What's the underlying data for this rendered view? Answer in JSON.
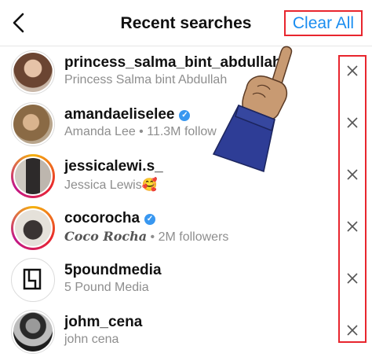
{
  "header": {
    "back_icon": "chevron-left-icon",
    "title": "Recent searches",
    "clear_all_label": "Clear All"
  },
  "colors": {
    "accent_blue": "#1a8df0",
    "highlight_red": "#e8262e",
    "verified_blue": "#3897f0",
    "secondary_text": "#8e8e8e"
  },
  "results": [
    {
      "username": "princess_salma_bint_abdullah",
      "subtitle": "Princess Salma bint Abdullah",
      "verified": false,
      "story": false,
      "remove_icon": "close-icon"
    },
    {
      "username": "amandaeliselee",
      "subtitle": "Amanda Lee • 11.3M follow",
      "verified": true,
      "story": false,
      "remove_icon": "close-icon"
    },
    {
      "username": "jessicalewi.s_",
      "subtitle": "Jessica Lewis🥰",
      "verified": false,
      "story": true,
      "remove_icon": "close-icon"
    },
    {
      "username": "cocorocha",
      "subtitle_name": "Coco Rocha",
      "subtitle_rest": " • 2M followers",
      "verified": true,
      "story": true,
      "remove_icon": "close-icon"
    },
    {
      "username": "5poundmedia",
      "subtitle": "5 Pound Media",
      "verified": false,
      "story": false,
      "remove_icon": "close-icon"
    },
    {
      "username": "johm_cena",
      "subtitle": "john cena",
      "verified": false,
      "story": false,
      "remove_icon": "close-icon"
    }
  ],
  "overlay": {
    "pointer_icon": "pointing-hand-icon"
  }
}
